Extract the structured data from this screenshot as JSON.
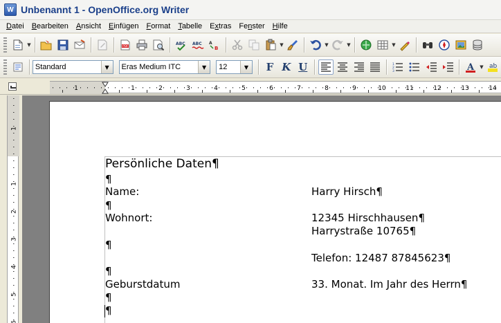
{
  "window": {
    "title": "Unbenannt 1 - OpenOffice.org Writer",
    "app_icon": "writer-document-icon"
  },
  "menu": [
    {
      "label": "Datei",
      "mnemonic": "D",
      "rest": "atei"
    },
    {
      "label": "Bearbeiten",
      "mnemonic": "B",
      "rest": "earbeiten"
    },
    {
      "label": "Ansicht",
      "mnemonic": "A",
      "rest": "nsicht"
    },
    {
      "label": "Einfügen",
      "mnemonic": "E",
      "rest": "infügen"
    },
    {
      "label": "Format",
      "mnemonic": "F",
      "rest": "ormat"
    },
    {
      "label": "Tabelle",
      "mnemonic": "T",
      "rest": "abelle"
    },
    {
      "label": "Extras",
      "mnemonic": "x",
      "pre": "E",
      "rest": "tras"
    },
    {
      "label": "Fenster",
      "mnemonic": "n",
      "pre": "Fe",
      "rest": "ster"
    },
    {
      "label": "Hilfe",
      "mnemonic": "H",
      "rest": "ilfe"
    }
  ],
  "formatting": {
    "style": "Standard",
    "font": "Eras Medium ITC",
    "size": "12",
    "bold": "F",
    "italic": "K",
    "underline": "U"
  },
  "ruler": {
    "h_numbers": [
      "1",
      "1",
      "2",
      "3",
      "4",
      "5",
      "6",
      "7",
      "8",
      "9",
      "10",
      "11",
      "12",
      "13",
      "14"
    ],
    "v_numbers": [
      "1",
      "1",
      "2",
      "3",
      "4",
      "5",
      "6"
    ]
  },
  "document": {
    "pilcrow": "¶",
    "heading": "Persönliche Daten",
    "rows": [
      {
        "label": "Name:",
        "value": "Harry Hirsch"
      },
      {
        "label": "Wohnort:",
        "value": "12345 Hirschhausen",
        "value2": "Harrystraße 10765"
      },
      {
        "label": "",
        "value": "Telefon: 12487 87845623"
      },
      {
        "label": "Geburstdatum",
        "value": "33. Monat. Im Jahr des Herrn"
      }
    ]
  },
  "colors": {
    "title_text": "#1a3f8a",
    "doc_background": "#808080",
    "page": "#ffffff"
  }
}
